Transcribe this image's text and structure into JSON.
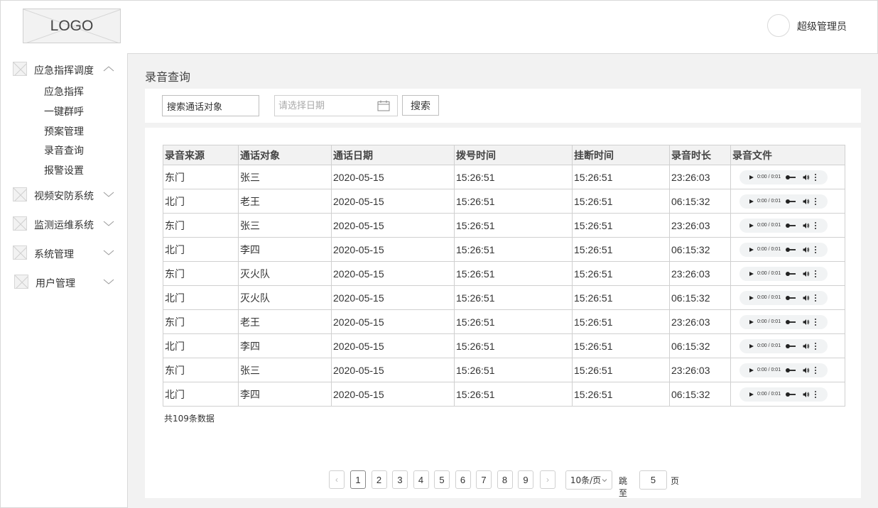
{
  "header": {
    "logo_text": "LOGO",
    "user_name": "超级管理员"
  },
  "sidebar": {
    "groups": [
      {
        "label": "应急指挥调度",
        "expanded": true,
        "items": [
          "应急指挥",
          "一键群呼",
          "预案管理",
          "录音查询",
          "报警设置"
        ]
      },
      {
        "label": "视频安防系统",
        "expanded": false
      },
      {
        "label": "监测运维系统",
        "expanded": false
      },
      {
        "label": "系统管理",
        "expanded": false
      },
      {
        "label": "用户管理",
        "expanded": false
      }
    ]
  },
  "page": {
    "title": "录音查询"
  },
  "search": {
    "target_value": "搜索通话对象",
    "date_placeholder": "请选择日期",
    "search_label": "搜索"
  },
  "table": {
    "columns": [
      "录音来源",
      "通话对象",
      "通话日期",
      "拨号时间",
      "挂断时间",
      "录音时长",
      "录音文件"
    ],
    "audio_time": "0:00 / 0:01",
    "rows": [
      [
        "东门",
        "张三",
        "2020-05-15",
        "15:26:51",
        "15:26:51",
        "23:26:03"
      ],
      [
        "北门",
        "老王",
        "2020-05-15",
        "15:26:51",
        "15:26:51",
        "06:15:32"
      ],
      [
        "东门",
        "张三",
        "2020-05-15",
        "15:26:51",
        "15:26:51",
        "23:26:03"
      ],
      [
        "北门",
        "李四",
        "2020-05-15",
        "15:26:51",
        "15:26:51",
        "06:15:32"
      ],
      [
        "东门",
        "灭火队",
        "2020-05-15",
        "15:26:51",
        "15:26:51",
        "23:26:03"
      ],
      [
        "北门",
        "灭火队",
        "2020-05-15",
        "15:26:51",
        "15:26:51",
        "06:15:32"
      ],
      [
        "东门",
        "老王",
        "2020-05-15",
        "15:26:51",
        "15:26:51",
        "23:26:03"
      ],
      [
        "北门",
        "李四",
        "2020-05-15",
        "15:26:51",
        "15:26:51",
        "06:15:32"
      ],
      [
        "东门",
        "张三",
        "2020-05-15",
        "15:26:51",
        "15:26:51",
        "23:26:03"
      ],
      [
        "北门",
        "李四",
        "2020-05-15",
        "15:26:51",
        "15:26:51",
        "06:15:32"
      ]
    ],
    "total_text": "共109条数据"
  },
  "pagination": {
    "prev": "‹",
    "next": "›",
    "pages": [
      "1",
      "2",
      "3",
      "4",
      "5",
      "6",
      "7",
      "8",
      "9"
    ],
    "current_page": "1",
    "page_size": "10条/页",
    "jump_label": "跳至",
    "jump_value": "5",
    "page_unit": "页"
  },
  "colors": {
    "background": "#f2f2f2",
    "panel": "#ffffff",
    "border": "#d0d0d0",
    "text": "#333333"
  }
}
